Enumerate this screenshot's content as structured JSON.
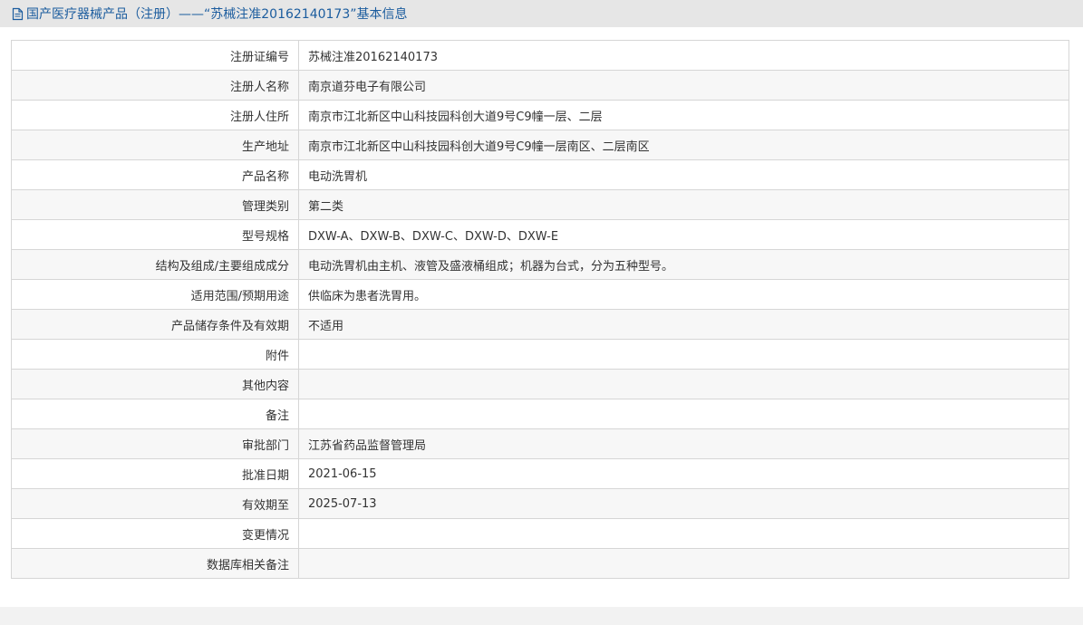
{
  "header": {
    "icon": "document-icon",
    "title": "国产医疗器械产品（注册）——“苏械注准20162140173”基本信息"
  },
  "rows": [
    {
      "label": "注册证编号",
      "value": "苏械注准20162140173"
    },
    {
      "label": "注册人名称",
      "value": "南京道芬电子有限公司"
    },
    {
      "label": "注册人住所",
      "value": "南京市江北新区中山科技园科创大道9号C9幢一层、二层"
    },
    {
      "label": "生产地址",
      "value": "南京市江北新区中山科技园科创大道9号C9幢一层南区、二层南区"
    },
    {
      "label": "产品名称",
      "value": "电动洗胃机"
    },
    {
      "label": "管理类别",
      "value": "第二类"
    },
    {
      "label": "型号规格",
      "value": "DXW-A、DXW-B、DXW-C、DXW-D、DXW-E"
    },
    {
      "label": "结构及组成/主要组成成分",
      "value": "电动洗胃机由主机、液管及盛液桶组成；机器为台式，分为五种型号。"
    },
    {
      "label": "适用范围/预期用途",
      "value": "供临床为患者洗胃用。"
    },
    {
      "label": "产品储存条件及有效期",
      "value": "不适用"
    },
    {
      "label": "附件",
      "value": ""
    },
    {
      "label": "其他内容",
      "value": ""
    },
    {
      "label": "备注",
      "value": ""
    },
    {
      "label": "审批部门",
      "value": "江苏省药品监督管理局"
    },
    {
      "label": "批准日期",
      "value": "2021-06-15"
    },
    {
      "label": "有效期至",
      "value": "2025-07-13"
    },
    {
      "label": "变更情况",
      "value": ""
    },
    {
      "label": "数据库相关备注",
      "value": ""
    }
  ]
}
